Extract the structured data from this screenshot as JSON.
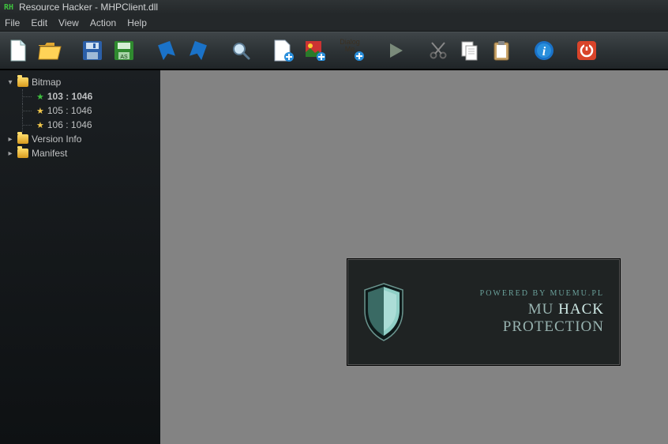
{
  "window": {
    "title": "Resource Hacker - MHPClient.dll",
    "app_icon_text": "RH"
  },
  "menubar": {
    "items": [
      "File",
      "Edit",
      "View",
      "Action",
      "Help"
    ]
  },
  "toolbar": {
    "new": "new-file",
    "open": "open-folder",
    "save": "save",
    "saveas": "save-as",
    "bookmarkL": "bookmark-left",
    "bookmarkR": "bookmark-right",
    "find": "find",
    "addbin": "add-binary",
    "addimg": "add-image",
    "dialog": "Dialog",
    "dialog2": "Me",
    "run": "run",
    "cut": "cut",
    "copy": "copy",
    "paste": "paste",
    "info": "info",
    "power": "power"
  },
  "tree": {
    "root": [
      {
        "label": "Bitmap",
        "expanded": true,
        "children": [
          {
            "label": "103 : 1046",
            "selected": true,
            "star": "green"
          },
          {
            "label": "105 : 1046",
            "star": "yellow"
          },
          {
            "label": "106 : 1046",
            "star": "yellow"
          }
        ]
      },
      {
        "label": "Version Info",
        "expanded": false
      },
      {
        "label": "Manifest",
        "expanded": false
      }
    ]
  },
  "preview": {
    "subtitle": "POWERED BY MUEMU.PL",
    "main_pre": "MU ",
    "main_strong": "HACK",
    "main_post": " PROTECTION"
  }
}
